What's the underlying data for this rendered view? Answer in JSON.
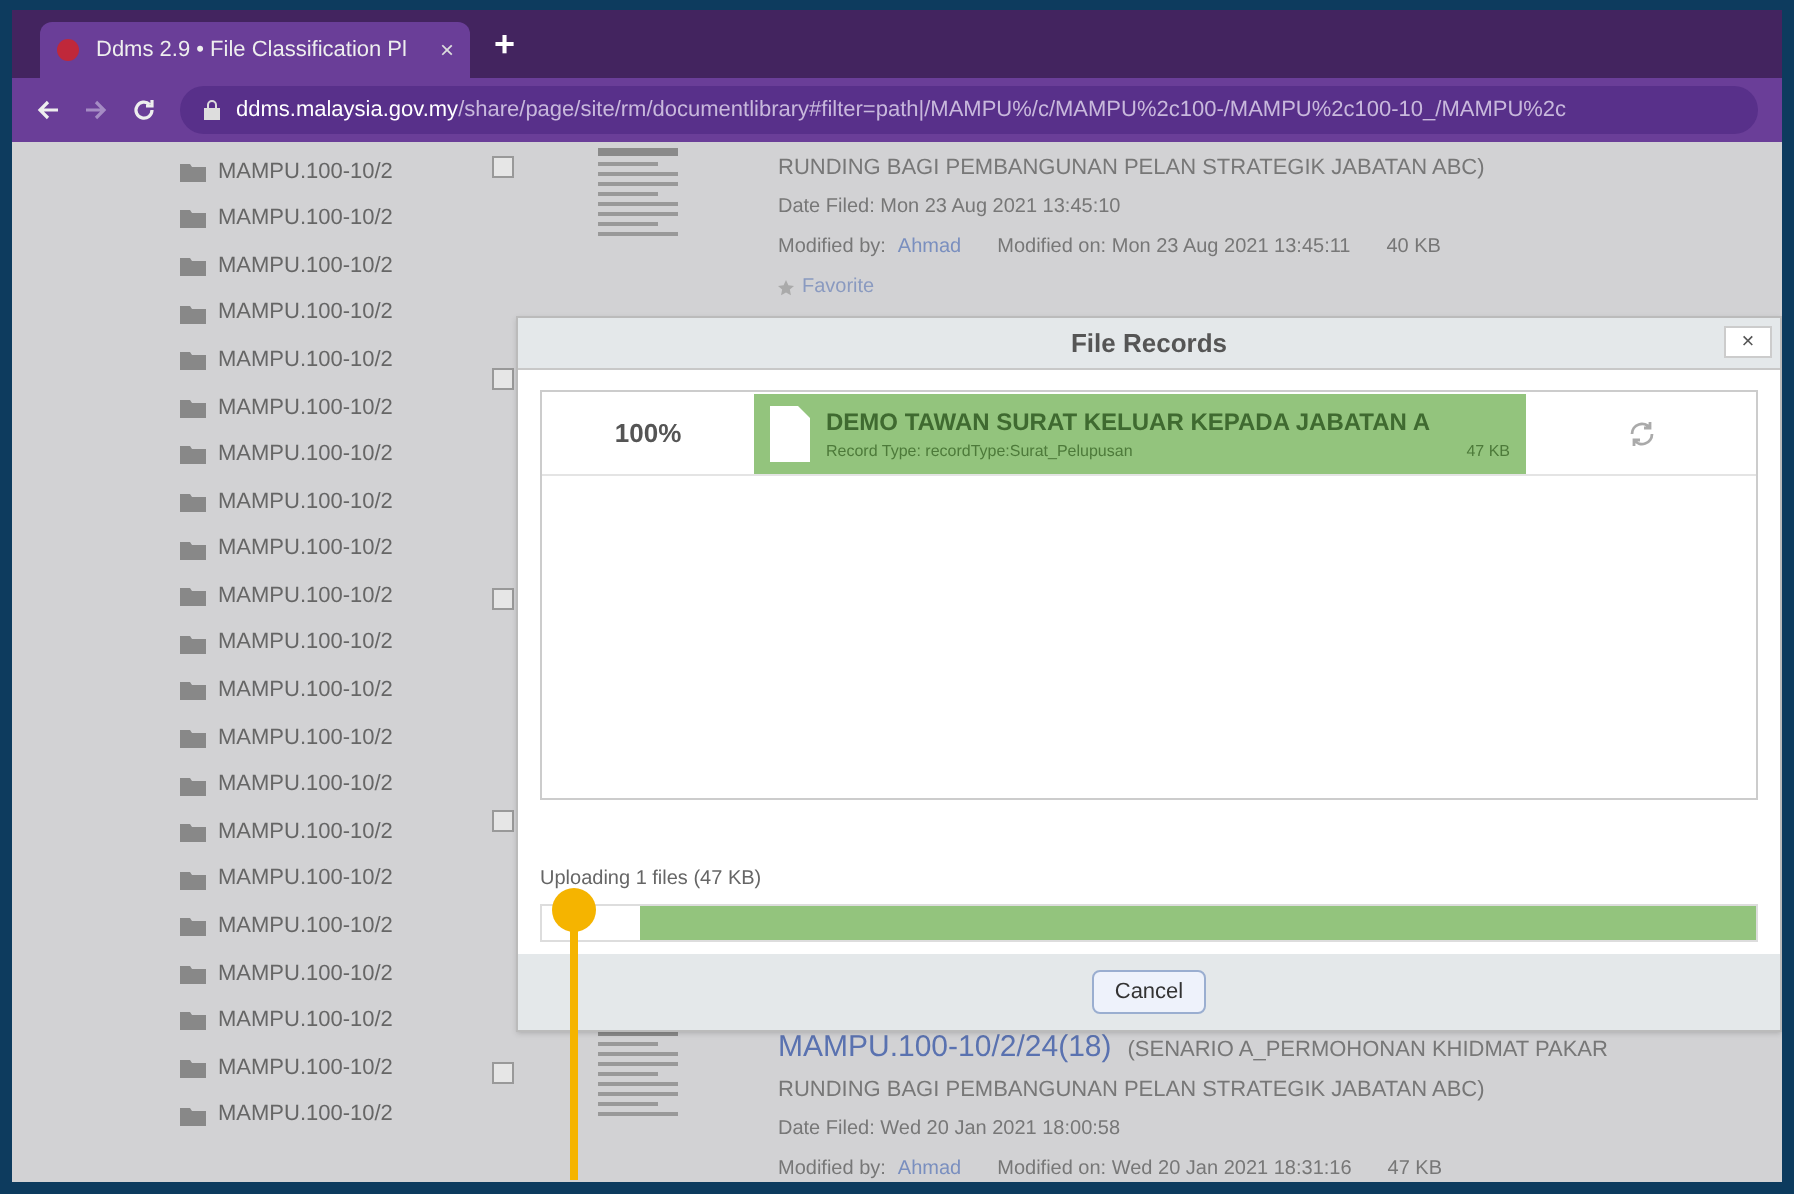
{
  "browser": {
    "tab_title": "Ddms 2.9 • File Classification Pl",
    "tab_close": "×",
    "new_tab": "+",
    "address_host": "ddms.malaysia.gov.my",
    "address_path": "/share/page/site/rm/documentlibrary#filter=path|/MAMPU%/c/MAMPU%2c100-/MAMPU%2c100-10_/MAMPU%2c"
  },
  "folders": [
    {
      "label": "MAMPU.100-10/2"
    },
    {
      "label": "MAMPU.100-10/2"
    },
    {
      "label": "MAMPU.100-10/2"
    },
    {
      "label": "MAMPU.100-10/2"
    },
    {
      "label": "MAMPU.100-10/2"
    },
    {
      "label": "MAMPU.100-10/2"
    },
    {
      "label": "MAMPU.100-10/2"
    },
    {
      "label": "MAMPU.100-10/2"
    },
    {
      "label": "MAMPU.100-10/2"
    },
    {
      "label": "MAMPU.100-10/2"
    },
    {
      "label": "MAMPU.100-10/2"
    },
    {
      "label": "MAMPU.100-10/2"
    },
    {
      "label": "MAMPU.100-10/2"
    },
    {
      "label": "MAMPU.100-10/2"
    },
    {
      "label": "MAMPU.100-10/2"
    },
    {
      "label": "MAMPU.100-10/2"
    },
    {
      "label": "MAMPU.100-10/2"
    },
    {
      "label": "MAMPU.100-10/2"
    },
    {
      "label": "MAMPU.100-10/2"
    },
    {
      "label": "MAMPU.100-10/2"
    },
    {
      "label": "MAMPU.100-10/2"
    }
  ],
  "records": [
    {
      "checked": false,
      "title_lines": [
        "RUNDING BAGI PEMBANGUNAN PELAN STRATEGIK JABATAN ABC)"
      ],
      "date_filed": "Date Filed: Mon 23 Aug 2021 13:45:10",
      "modified_by_label": "Modified by:",
      "modified_by": "Ahmad",
      "modified_on": "Modified on: Mon 23 Aug 2021 13:45:11",
      "size": "40 KB",
      "favorite": "Favorite"
    },
    {
      "checked": false
    },
    {
      "checked": false
    },
    {
      "checked": false
    },
    {
      "checked": false,
      "name": "MAMPU.100-10/2/24(18)",
      "title_lines": [
        "(SENARIO A_PERMOHONAN KHIDMAT PAKAR",
        "RUNDING BAGI PEMBANGUNAN PELAN STRATEGIK JABATAN ABC)"
      ],
      "date_filed": "Date Filed: Wed 20 Jan 2021 18:00:58",
      "modified_by_label": "Modified by:",
      "modified_by": "Ahmad",
      "modified_on": "Modified on: Wed 20 Jan 2021 18:31:16",
      "size": "47 KB"
    }
  ],
  "dialog": {
    "title": "File Records",
    "close": "×",
    "uploads": [
      {
        "percent": "100%",
        "name": "DEMO TAWAN SURAT KELUAR KEPADA JABATAN A",
        "record_type": "Record Type: recordType:Surat_Pelupusan",
        "size": "47 KB"
      }
    ],
    "status": "Uploading 1 files (47 KB)",
    "progress": {
      "level": 0.92
    },
    "cancel": "Cancel"
  }
}
